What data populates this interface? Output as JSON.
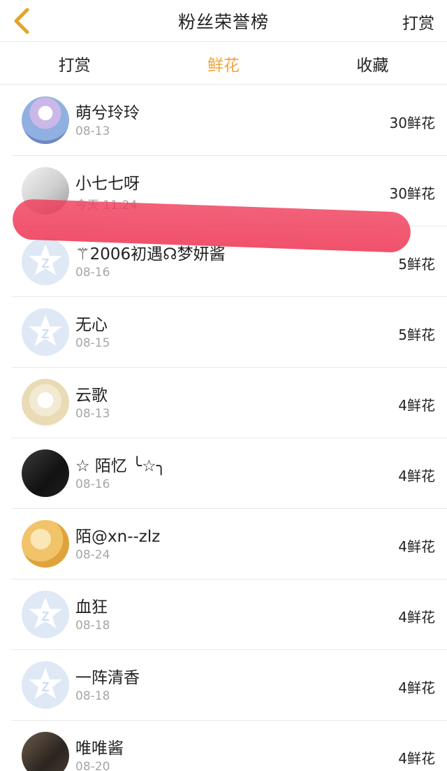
{
  "header": {
    "title": "粉丝荣誉榜",
    "right_action": "打赏"
  },
  "tabs": [
    {
      "label": "打赏",
      "active": false
    },
    {
      "label": "鲜花",
      "active": true
    },
    {
      "label": "收藏",
      "active": false
    }
  ],
  "colors": {
    "accent": "#f2a33a",
    "text": "#222222",
    "subtext": "#a6a6a6",
    "divider": "#e8e8e8"
  },
  "fans": [
    {
      "name": "萌兮玲玲",
      "date": "08-13",
      "amount": "30鲜花",
      "avatar": "girl-illustration"
    },
    {
      "name": "小七七呀",
      "date": "今天 11:24",
      "amount": "30鲜花",
      "avatar": "photo"
    },
    {
      "name": "⚚2006初遇☊梦妍酱",
      "date": "08-16",
      "amount": "5鲜花",
      "avatar": "default-qq-star"
    },
    {
      "name": "无心",
      "date": "08-15",
      "amount": "5鲜花",
      "avatar": "default-qq-star"
    },
    {
      "name": "云歌",
      "date": "08-13",
      "amount": "4鲜花",
      "avatar": "anime-girl"
    },
    {
      "name": "☆ 陌忆 ╰☆╮",
      "date": "08-16",
      "amount": "4鲜花",
      "avatar": "photo-dark"
    },
    {
      "name": "陌@xn--zlz",
      "date": "08-24",
      "amount": "4鲜花",
      "avatar": "photo-yellow"
    },
    {
      "name": "血狂",
      "date": "08-18",
      "amount": "4鲜花",
      "avatar": "default-qq-star"
    },
    {
      "name": "一阵清香",
      "date": "08-18",
      "amount": "4鲜花",
      "avatar": "default-qq-star"
    },
    {
      "name": "唯唯酱",
      "date": "08-20",
      "amount": "4鲜花",
      "avatar": "photo-dark"
    }
  ]
}
